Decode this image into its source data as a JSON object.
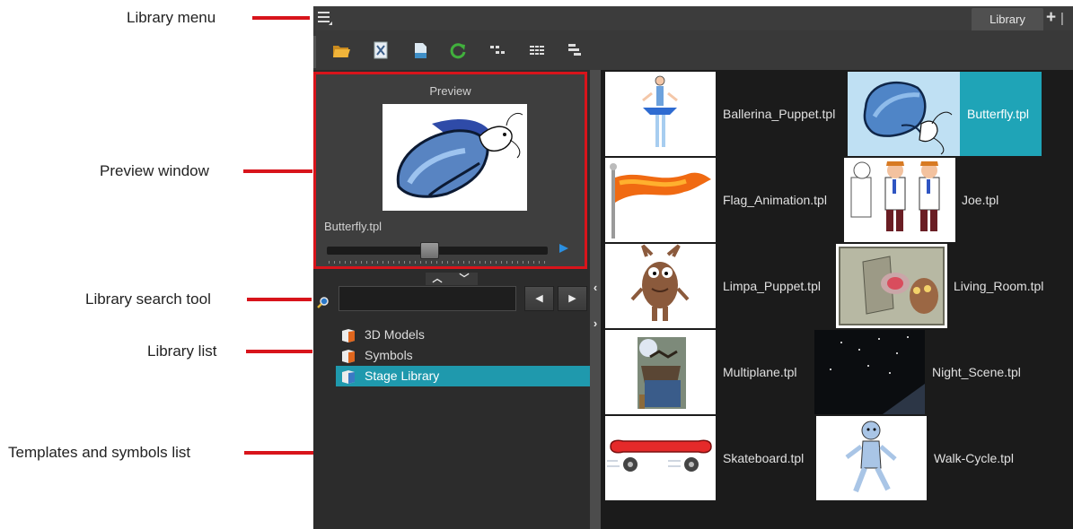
{
  "callouts": {
    "library_menu": "Library menu",
    "preview_window": "Preview window",
    "search_tool": "Library search tool",
    "library_list": "Library list",
    "templates_list": "Templates and symbols list"
  },
  "window": {
    "tab_label": "Library",
    "add_tab_icon": "plus-icon",
    "close_icon": "close-icon"
  },
  "toolbar": {
    "tools": [
      "open-library-icon",
      "new-folder-icon",
      "new-symbol-icon",
      "refresh-icon",
      "thumbnails-icon",
      "list-view-icon",
      "details-icon"
    ]
  },
  "preview": {
    "title": "Preview",
    "selected_name": "Butterfly.tpl",
    "slider_position": 0.46,
    "play_icon": "play-icon"
  },
  "search": {
    "value": "",
    "prev_label": "◀",
    "next_label": "▶"
  },
  "library_list": [
    {
      "label": "3D Models",
      "selected": false
    },
    {
      "label": "Symbols",
      "selected": false
    },
    {
      "label": "Stage Library",
      "selected": true
    }
  ],
  "templates": [
    {
      "name": "Ballerina_Puppet.tpl",
      "selected": false
    },
    {
      "name": "Butterfly.tpl",
      "selected": true
    },
    {
      "name": "Flag_Animation.tpl",
      "selected": false
    },
    {
      "name": "Joe.tpl",
      "selected": false
    },
    {
      "name": "Limpa_Puppet.tpl",
      "selected": false
    },
    {
      "name": "Living_Room.tpl",
      "selected": false
    },
    {
      "name": "Multiplane.tpl",
      "selected": false
    },
    {
      "name": "Night_Scene.tpl",
      "selected": false
    },
    {
      "name": "Skateboard.tpl",
      "selected": false
    },
    {
      "name": "Walk-Cycle.tpl",
      "selected": false
    }
  ],
  "colors": {
    "callout_red": "#d8141b",
    "selection_teal": "#1fa4b7",
    "list_selection": "#1f99ad",
    "panel_bg": "#2c2c2c"
  }
}
